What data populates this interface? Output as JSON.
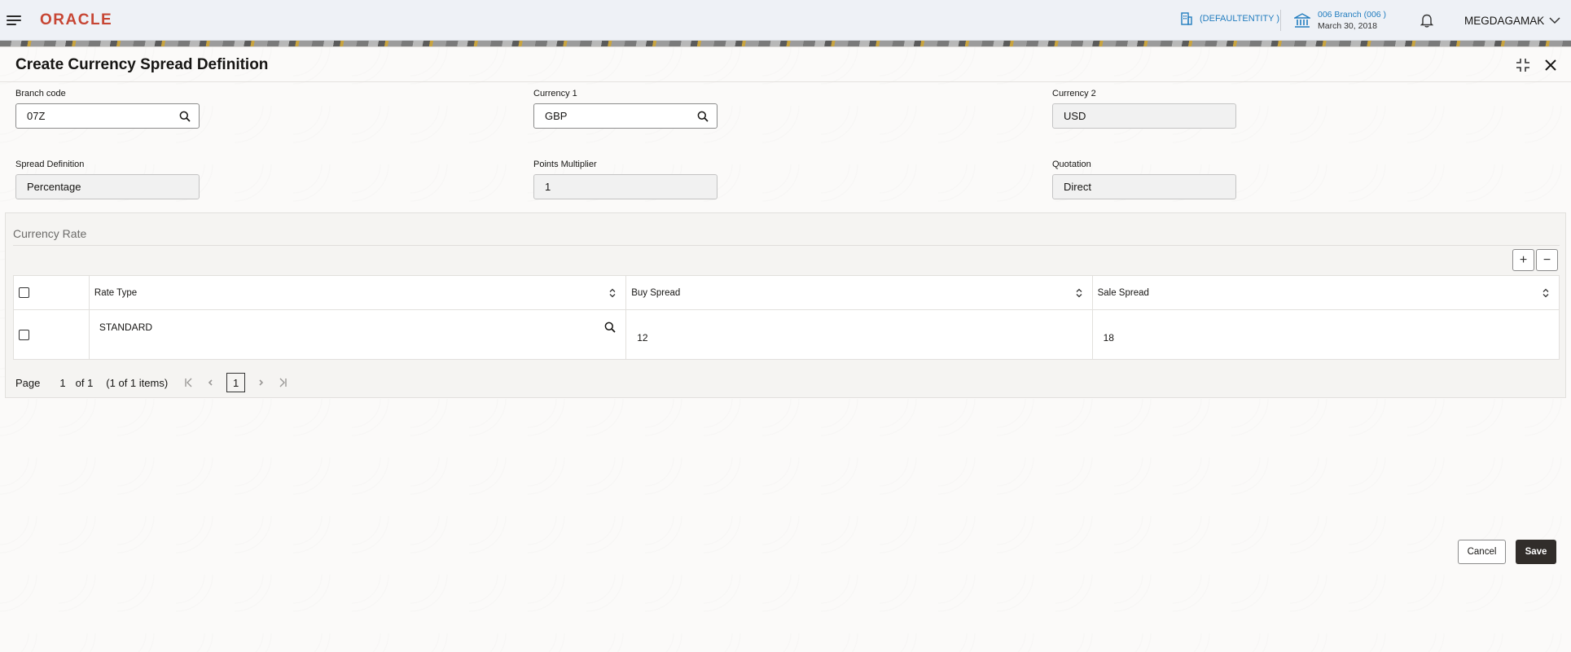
{
  "header": {
    "brand": "ORACLE",
    "entity": "(DEFAULTENTITY )",
    "branch_name": "006 Branch (006 )",
    "branch_date": "March 30, 2018",
    "user": "MEGDAGAMAK"
  },
  "modal": {
    "title": "Create Currency Spread Definition"
  },
  "fields": {
    "branch_code": {
      "label": "Branch code",
      "value": "07Z"
    },
    "currency1": {
      "label": "Currency 1",
      "value": "GBP"
    },
    "currency2": {
      "label": "Currency 2",
      "value": "USD"
    },
    "spread_definition": {
      "label": "Spread Definition",
      "value": "Percentage"
    },
    "points_multiplier": {
      "label": "Points Multiplier",
      "value": "1"
    },
    "quotation": {
      "label": "Quotation",
      "value": "Direct"
    }
  },
  "currency_rate": {
    "title": "Currency Rate",
    "add_label": "+",
    "remove_label": "−",
    "columns": [
      "Rate Type",
      "Buy Spread",
      "Sale Spread"
    ],
    "rows": [
      {
        "rate_type": "STANDARD",
        "buy_spread": "12",
        "sale_spread": "18"
      }
    ]
  },
  "pager": {
    "page_label": "Page",
    "page_value": "1",
    "of_label": "of 1",
    "items_label": "(1 of 1 items)",
    "current": "1"
  },
  "footer": {
    "cancel_label": "Cancel",
    "save_label": "Save"
  },
  "colors": {
    "brand": "#c74634",
    "link": "#227dbf",
    "primary_button": "#312d2a"
  }
}
